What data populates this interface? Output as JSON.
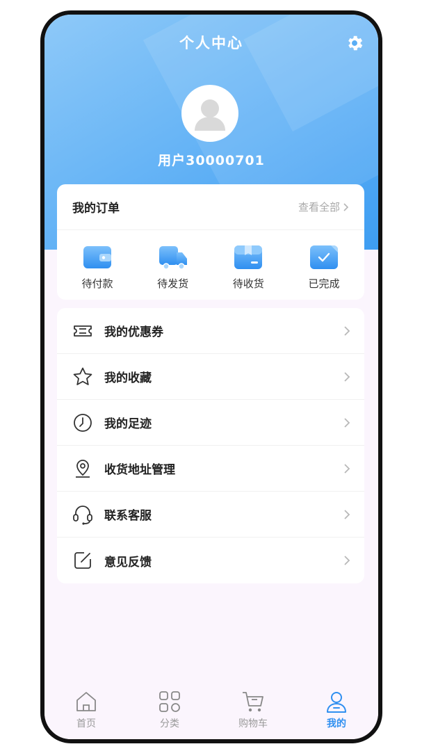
{
  "header": {
    "title": "个人中心",
    "username": "用户30000701",
    "settings_icon": "gear-icon",
    "avatar_icon": "user-avatar-icon"
  },
  "orders": {
    "title": "我的订单",
    "view_all": "查看全部",
    "items": [
      {
        "label": "待付款",
        "icon": "wallet-icon"
      },
      {
        "label": "待发货",
        "icon": "truck-icon"
      },
      {
        "label": "待收货",
        "icon": "package-icon"
      },
      {
        "label": "已完成",
        "icon": "check-icon"
      }
    ]
  },
  "menu": [
    {
      "label": "我的优惠券",
      "icon": "ticket-icon"
    },
    {
      "label": "我的收藏",
      "icon": "star-icon"
    },
    {
      "label": "我的足迹",
      "icon": "clock-icon"
    },
    {
      "label": "收货地址管理",
      "icon": "location-pin-icon"
    },
    {
      "label": "联系客服",
      "icon": "headset-icon"
    },
    {
      "label": "意见反馈",
      "icon": "edit-icon"
    }
  ],
  "tabbar": [
    {
      "label": "首页",
      "icon": "home-icon",
      "active": false
    },
    {
      "label": "分类",
      "icon": "category-icon",
      "active": false
    },
    {
      "label": "购物车",
      "icon": "cart-icon",
      "active": false
    },
    {
      "label": "我的",
      "icon": "user-icon",
      "active": true
    }
  ],
  "colors": {
    "accent": "#2f8ff0",
    "header_gradient_start": "#8ec9f8",
    "header_gradient_end": "#3d9df2",
    "page_background": "#fbf5fd"
  }
}
